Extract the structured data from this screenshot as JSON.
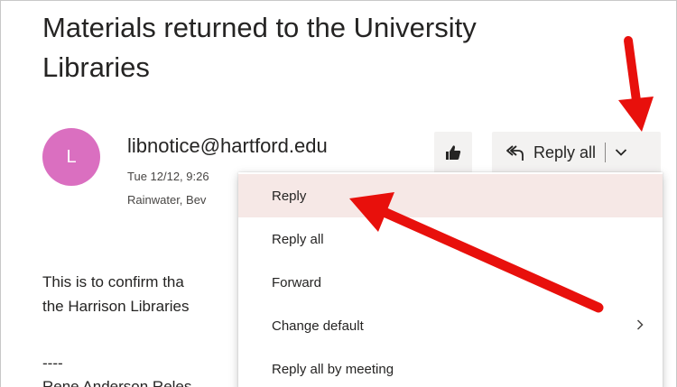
{
  "message": {
    "subject": "Materials returned to the University Libraries",
    "avatar_initial": "L",
    "sender": "libnotice@hartford.edu",
    "sent": "Tue 12/12, 9:26",
    "recipient": "Rainwater, Bev",
    "body_line1": "This is to confirm tha",
    "body_line2": "the Harrison Libraries",
    "separator": "----",
    "body_tail": "Rene Anderson Reles"
  },
  "actions": {
    "like_icon": "thumbs-up-icon",
    "reply_all_icon": "reply-all-icon",
    "reply_all_label": "Reply all",
    "dropdown_icon": "chevron-down-icon"
  },
  "menu": {
    "items": [
      {
        "label": "Reply"
      },
      {
        "label": "Reply all"
      },
      {
        "label": "Forward"
      },
      {
        "label": "Change default"
      },
      {
        "label": "Reply all by meeting"
      }
    ],
    "submenu_icon": "chevron-right-icon"
  },
  "annotations": {
    "arrow_color": "#e8100c"
  },
  "colors": {
    "avatar": "#da6fc0",
    "button_bg": "#f3f2f1",
    "highlight": "#f6e8e6"
  }
}
